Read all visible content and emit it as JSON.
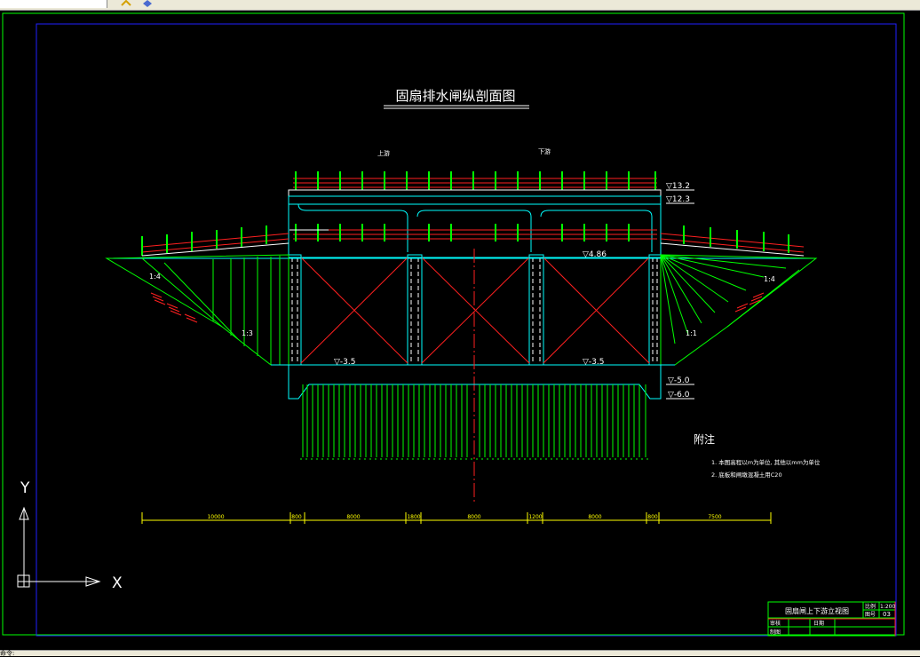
{
  "drawing": {
    "title": "固扇排水闸纵剖面图",
    "upstream": "上游",
    "downstream": "下游",
    "elevations": {
      "e1": "▽13.2",
      "e2": "▽12.3",
      "e3": "▽4.86",
      "e4": "▽-3.5",
      "e5": "▽-3.5",
      "e6": "▽-5.0",
      "e7": "▽-6.0"
    },
    "slopes": {
      "s1": "1:4",
      "s2": "1:3",
      "s3": "1:4",
      "s4": "1:1"
    },
    "dimensions": [
      "10000",
      "800",
      "8000",
      "1800",
      "8000",
      "1200",
      "8000",
      "800",
      "7500"
    ],
    "notes": {
      "heading": "附注",
      "line1": "1. 本图高程以m为单位, 其他以mm为单位",
      "line2": "2. 底板和闸墩混凝土用C20"
    },
    "axes": {
      "y": "Y",
      "x": "X"
    }
  },
  "title_block": {
    "name": "固扇闸上下游立视图",
    "scale_label": "比例",
    "scale_value": "1:200",
    "sheet_label": "图号",
    "sheet_value": "03",
    "review_label": "审核",
    "draw_label": "制图",
    "date_label": "日期"
  },
  "statusbar": {
    "text": "命令:"
  },
  "colors": {
    "cyan": "#00ffff",
    "green": "#00ff00",
    "red": "#ff2020",
    "yellow": "#ffff00",
    "white": "#ffffff",
    "blue_frame": "#2020ff"
  }
}
